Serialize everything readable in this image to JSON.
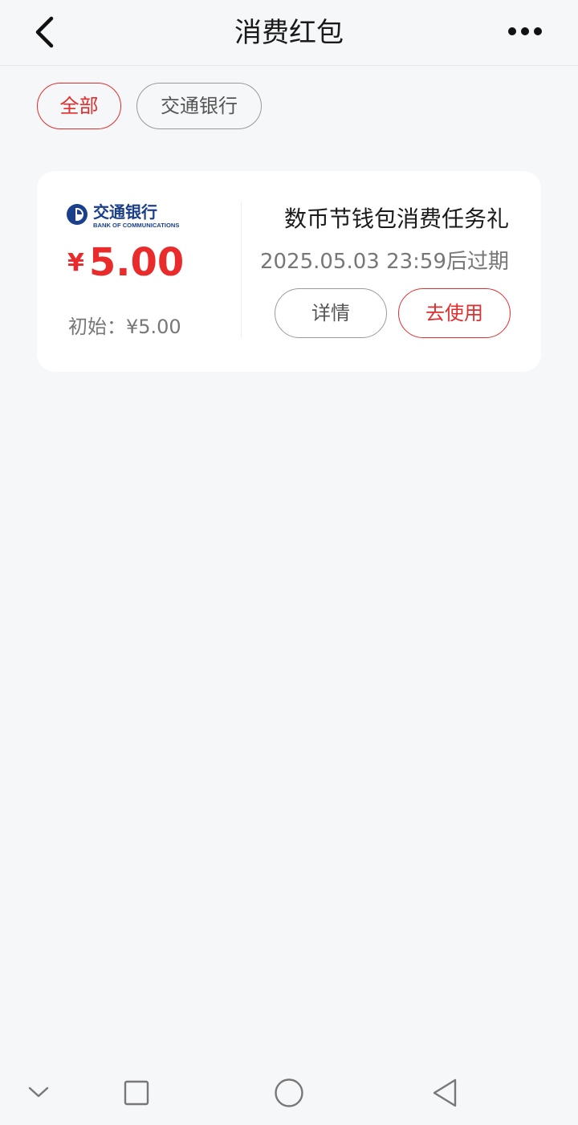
{
  "header": {
    "title": "消费红包",
    "back_icon": "chevron-left-icon",
    "more_icon": "more-horizontal-icon"
  },
  "filters": [
    {
      "label": "全部",
      "selected": true
    },
    {
      "label": "交通银行",
      "selected": false
    }
  ],
  "coupon": {
    "bank_name_cn": "交通银行",
    "bank_name_en": "BANK OF COMMUNICATIONS",
    "currency_symbol": "¥",
    "amount": "5.00",
    "initial_label": "初始：¥5.00",
    "name": "数币节钱包消费任务礼",
    "expire_text": "2025.05.03 23:59后过期",
    "detail_button": "详情",
    "use_button": "去使用"
  },
  "colors": {
    "accent": "#e12d2d",
    "amount": "#ea2b2b",
    "bank_blue": "#1b3f8b",
    "background": "#f6f7f9"
  },
  "system_nav": {
    "icons": [
      "chevron-down-icon",
      "square-icon",
      "circle-icon",
      "triangle-back-icon"
    ]
  }
}
